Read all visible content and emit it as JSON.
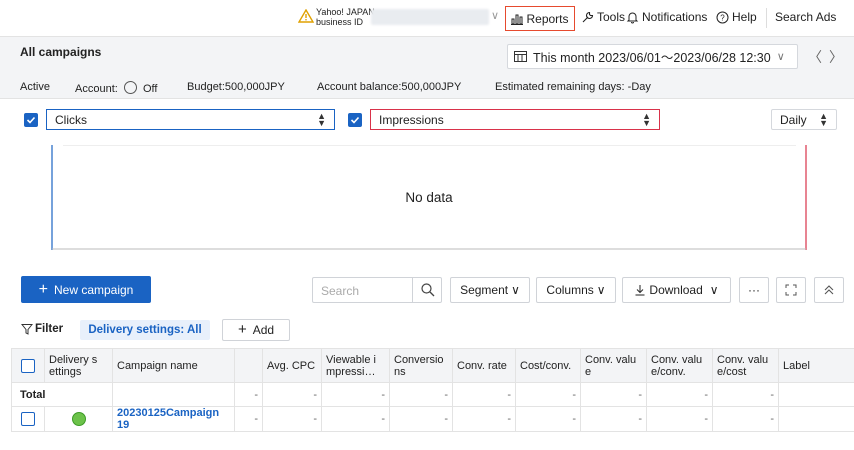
{
  "topnav": {
    "business_label_line1": "Yahoo! JAPAN",
    "business_label_line2": "business ID",
    "reports": "Reports",
    "tools": "Tools",
    "notifications": "Notifications",
    "help": "Help",
    "search_ads": "Search Ads"
  },
  "header": {
    "title": "All campaigns",
    "date_range": "This month 2023/06/01〜2023/06/28 12:30",
    "status_active": "Active",
    "account_label": "Account:",
    "account_toggle": "Off",
    "budget": "Budget:500,000JPY",
    "balance": "Account balance:500,000JPY",
    "remaining": "Estimated remaining days: -Day"
  },
  "chart_controls": {
    "metric1": "Clicks",
    "metric2": "Impressions",
    "interval": "Daily",
    "metric1_color": "#1a63c3",
    "metric2_color": "#d9324a"
  },
  "chart": {
    "empty_text": "No data"
  },
  "toolbar": {
    "new_campaign": "New campaign",
    "search_placeholder": "Search",
    "segment": "Segment",
    "columns": "Columns",
    "download": "Download",
    "more": "···"
  },
  "filter": {
    "label": "Filter",
    "chip": "Delivery settings: All",
    "add": "Add"
  },
  "table": {
    "headers": [
      "Delivery s ettings",
      "Campaign name",
      "",
      "Avg. CPC",
      "Viewable i mpressi…",
      "Conversio ns",
      "Conv. rate",
      "Cost/conv.",
      "Conv. valu e",
      "Conv. valu e/conv.",
      "Conv. valu e/cost",
      "Label"
    ],
    "total_label": "Total",
    "dash": "-",
    "row1_name": "20230125Campaign 19"
  }
}
